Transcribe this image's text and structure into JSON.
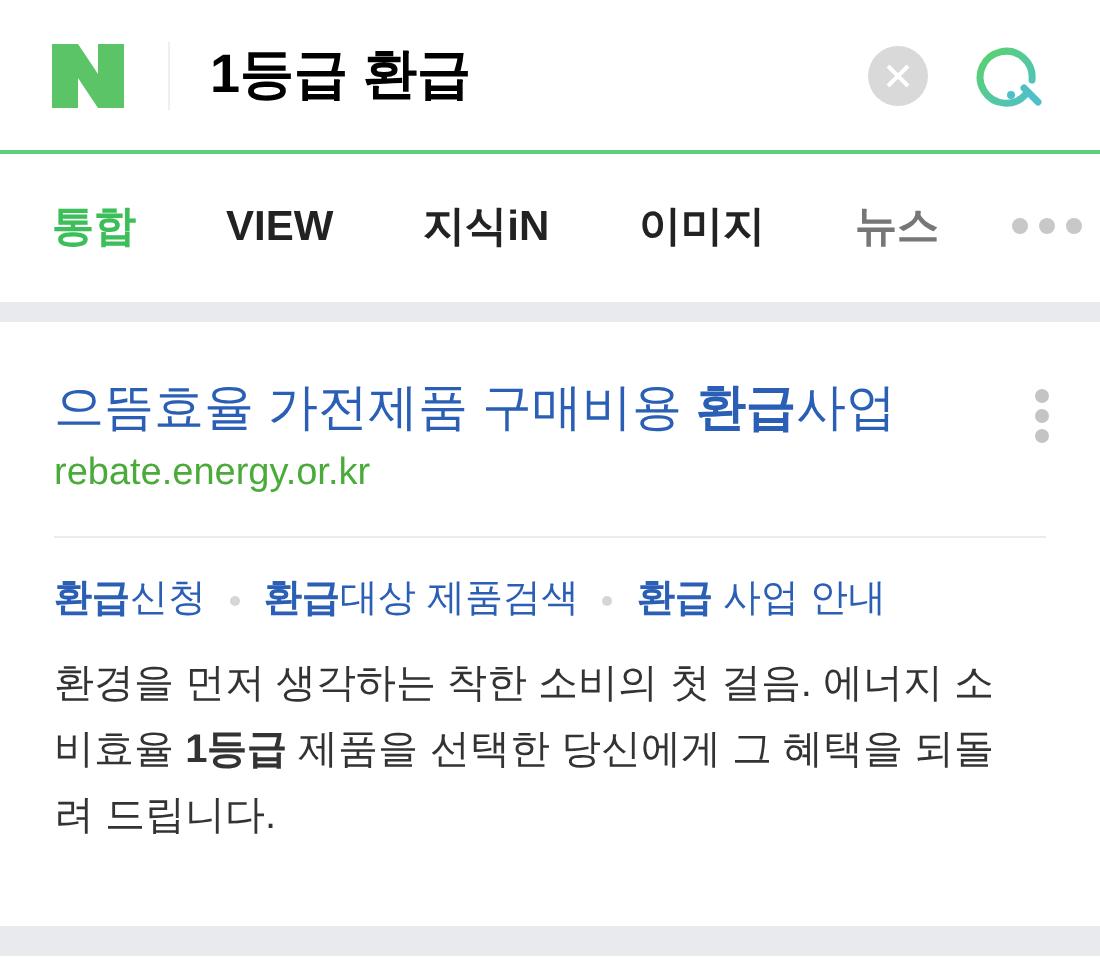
{
  "search_bar": {
    "query": "1등급 환급"
  },
  "tabs": [
    {
      "label": "통합",
      "selected": true
    },
    {
      "label": "VIEW",
      "selected": false
    },
    {
      "label": "지식iN",
      "selected": false
    },
    {
      "label": "이미지",
      "selected": false
    },
    {
      "label": "뉴스",
      "selected": false
    }
  ],
  "result": {
    "title": "으뜸효율 가전제품 구매비용 **환급**사업",
    "url": "rebate.energy.or.kr",
    "links": [
      "**환급**신청",
      "**환급**대상 제품검색",
      "**환급** 사업 안내"
    ],
    "description": "환경을 먼저 생각하는 착한 소비의 첫 걸음. 에너지 소비효율 **1등급** 제품을 선택한 당신에게 그 혜택을 되돌려 드립니다."
  }
}
